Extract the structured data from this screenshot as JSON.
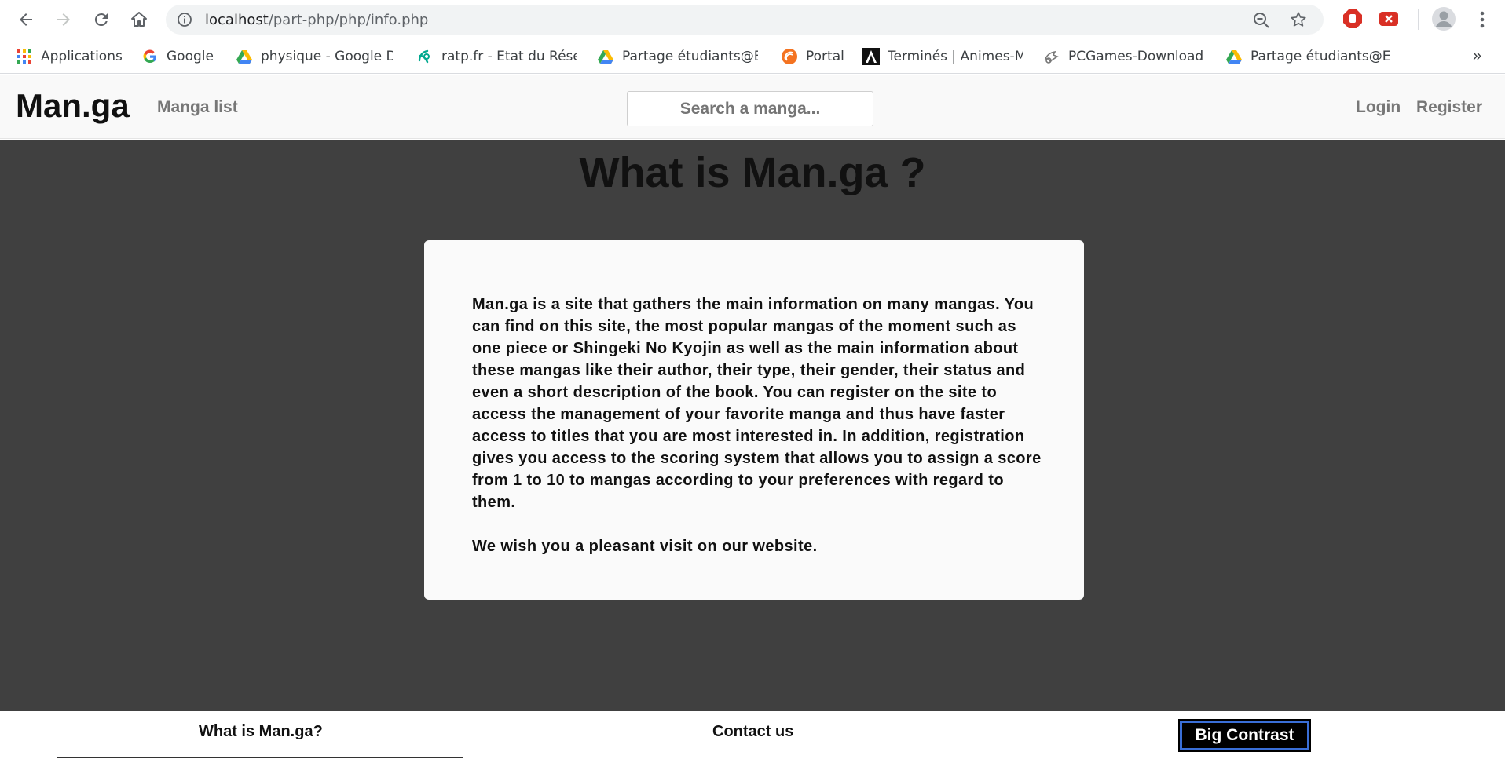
{
  "browser": {
    "url_host": "localhost",
    "url_path": "/part-php/php/info.php",
    "bookmarks": [
      {
        "label": "Applications",
        "icon": "apps-grid-icon"
      },
      {
        "label": "Google",
        "icon": "google-icon"
      },
      {
        "label": "physique - Google Dr",
        "icon": "google-drive-icon"
      },
      {
        "label": "ratp.fr - Etat du Résea",
        "icon": "ratp-icon"
      },
      {
        "label": "Partage étudiants@EF",
        "icon": "google-drive-icon"
      },
      {
        "label": "Portal",
        "icon": "portal-icon"
      },
      {
        "label": "Terminés | Animes-M",
        "icon": "animes-icon"
      },
      {
        "label": "PCGames-Download",
        "icon": "pcgames-icon"
      },
      {
        "label": "Partage étudiants@EF",
        "icon": "google-drive-icon"
      }
    ],
    "more_label": "»"
  },
  "header": {
    "brand": "Man.ga",
    "manga_list": "Manga list",
    "search_placeholder": "Search a manga...",
    "login": "Login",
    "register": "Register"
  },
  "main": {
    "title": "What is Man.ga ?",
    "description": "Man.ga is a site that gathers the main information on many mangas. You can find on this site, the most popular mangas of the moment such as one piece or Shingeki No Kyojin as well as the main information about these mangas like their author, their type, their gender, their status and even a short description of the book. You can register on the site to access the management of your favorite manga and thus have faster access to titles that you are most interested in. In addition, registration gives you access to the scoring system that allows you to assign a score from 1 to 10 to mangas according to your preferences with regard to them.",
    "closing": "We wish you a pleasant visit on our website."
  },
  "footer": {
    "what_is": "What is Man.ga?",
    "contact": "Contact us",
    "contrast_button": "Big Contrast"
  },
  "colors": {
    "main_background": "#404040",
    "card_background": "#fafafa",
    "header_background": "#f9f9f9",
    "contrast_button_bg": "#000000",
    "contrast_button_border": "#3a6fd8"
  }
}
